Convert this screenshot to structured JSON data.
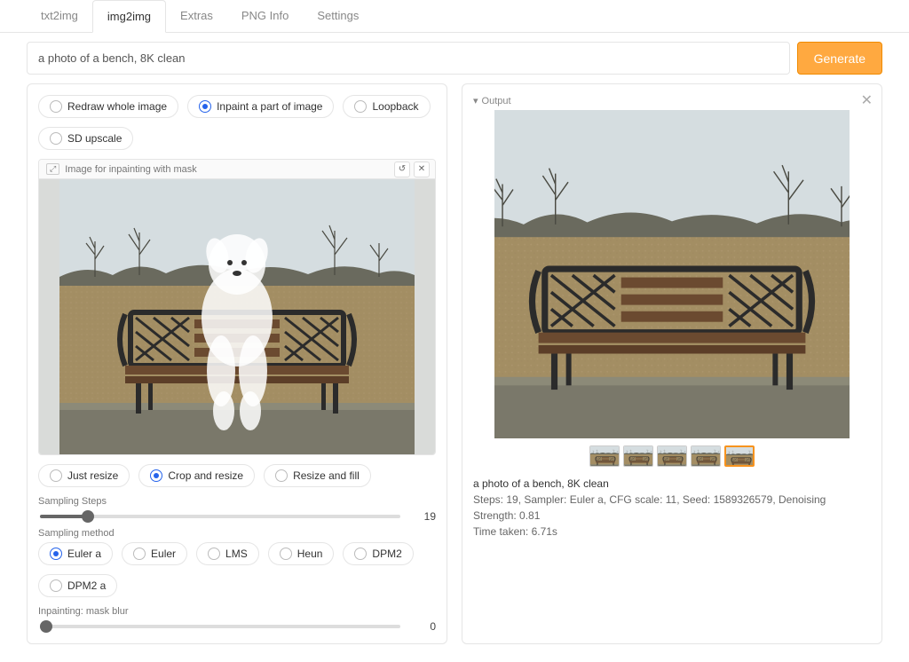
{
  "tabs": {
    "items": [
      "txt2img",
      "img2img",
      "Extras",
      "PNG Info",
      "Settings"
    ],
    "active_index": 1
  },
  "prompt": {
    "value": "a photo of a bench, 8K clean"
  },
  "generate_label": "Generate",
  "mode_radios": {
    "items": [
      "Redraw whole image",
      "Inpaint a part of image",
      "Loopback",
      "SD upscale"
    ],
    "selected_index": 1
  },
  "inpaint_panel": {
    "label": "Image for inpainting with mask",
    "undo_icon": "undo-icon",
    "close_icon": "close-icon"
  },
  "resize_radios": {
    "items": [
      "Just resize",
      "Crop and resize",
      "Resize and fill"
    ],
    "selected_index": 1
  },
  "sampling_steps": {
    "label": "Sampling Steps",
    "value": 19,
    "min": 1,
    "max": 150
  },
  "sampling_method": {
    "label": "Sampling method",
    "items": [
      "Euler a",
      "Euler",
      "LMS",
      "Heun",
      "DPM2",
      "DPM2 a"
    ],
    "selected_index": 0
  },
  "mask_blur": {
    "label": "Inpainting: mask blur",
    "value": 0,
    "min": 0,
    "max": 64
  },
  "output": {
    "label": "Output",
    "thumb_count": 5,
    "selected_thumb": 4,
    "prompt_echo": "a photo of a bench, 8K clean",
    "params_line": "Steps: 19, Sampler: Euler a, CFG scale: 11, Seed: 1589326579, Denoising Strength: 0.81",
    "time_line": "Time taken: 6.71s"
  }
}
